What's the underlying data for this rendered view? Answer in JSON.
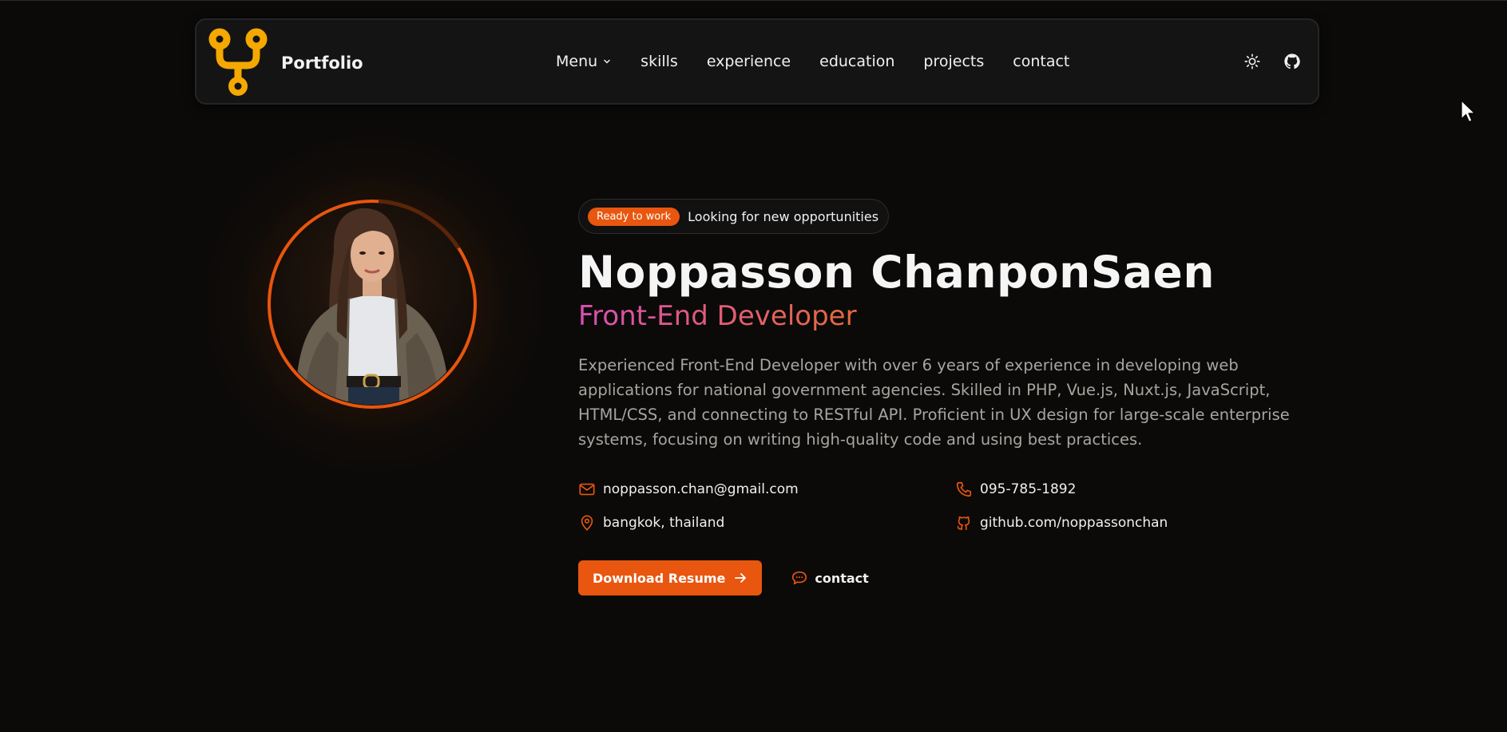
{
  "navbar": {
    "brand_name": "Portfolio",
    "logo_icon": "git-branch-logo",
    "links": [
      {
        "label": "Menu",
        "has_dropdown": true
      },
      {
        "label": "skills"
      },
      {
        "label": "experience"
      },
      {
        "label": "education"
      },
      {
        "label": "projects"
      },
      {
        "label": "contact"
      }
    ],
    "icons": [
      "sun-icon",
      "github-icon"
    ]
  },
  "hero": {
    "status_badge": "Ready to work",
    "status_text": "Looking for new opportunities",
    "name": "Noppasson ChanponSaen",
    "role": "Front-End Developer",
    "bio": "Experienced Front-End Developer with over 6 years of experience in developing web applications for national government agencies. Skilled in PHP, Vue.js, Nuxt.js, JavaScript, HTML/CSS, and connecting to RESTful API. Proficient in UX design for large-scale enterprise systems, focusing on writing high-quality code and using best practices.",
    "contacts": {
      "email": "noppasson.chan@gmail.com",
      "phone": "095-785-1892",
      "location": "bangkok, thailand",
      "github": "github.com/noppassonchan"
    },
    "actions": {
      "download_label": "Download Resume",
      "contact_label": "contact"
    }
  },
  "colors": {
    "accent": "#e8560f",
    "logo": "#f5a800",
    "background": "#0b0a09",
    "role_gradient_start": "#d94fb5",
    "role_gradient_end": "#e66a3b"
  }
}
